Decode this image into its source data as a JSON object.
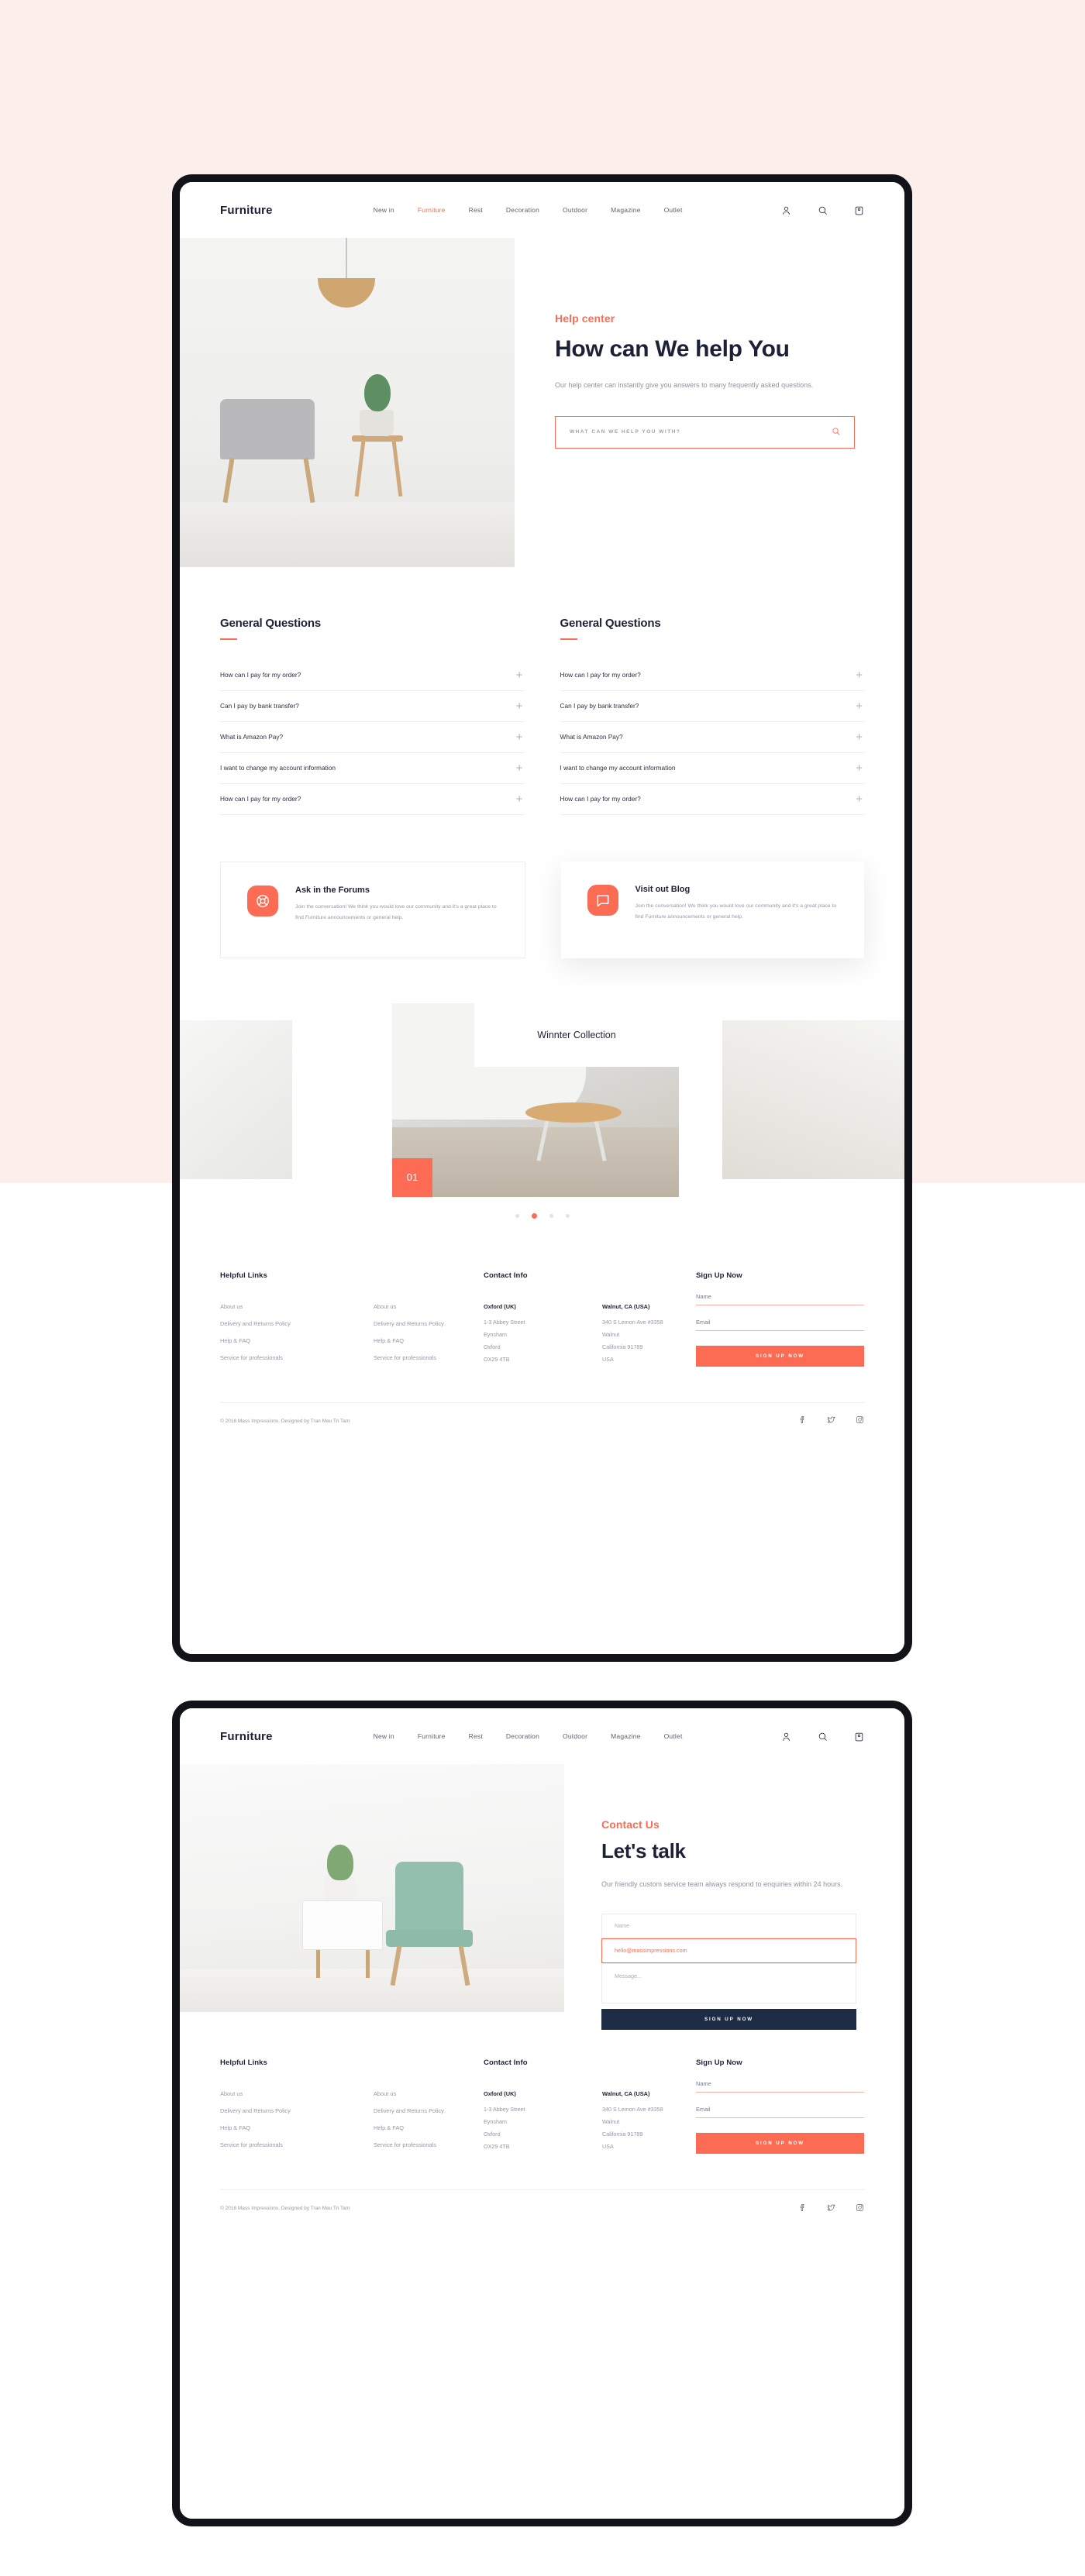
{
  "theme": {
    "page_background": "#fbeeeb",
    "accent": "#fc6b53",
    "dark": "#1d2136",
    "dark_button": "#1d2b44",
    "muted_text": "#9498a8"
  },
  "nav": {
    "brand": "Furniture",
    "links": [
      {
        "label": "New in",
        "active": false
      },
      {
        "label": "Furniture",
        "active": true
      },
      {
        "label": "Rest",
        "active": false
      },
      {
        "label": "Decoration",
        "active": false
      },
      {
        "label": "Outdoor",
        "active": false
      },
      {
        "label": "Magazine",
        "active": false
      },
      {
        "label": "Outlet",
        "active": false
      }
    ],
    "icons": [
      {
        "name": "user-icon"
      },
      {
        "name": "search-icon"
      },
      {
        "name": "cart-icon"
      }
    ]
  },
  "page1": {
    "hero": {
      "eyebrow": "Help center",
      "title": "How can We help You",
      "description": "Our help center can instantly give you answers to many frequently asked questions.",
      "search_placeholder": "WHAT CAN WE HELP YOU WITH?"
    },
    "faq_left": {
      "title": "General Questions",
      "items": [
        "How can I pay for my order?",
        "Can I pay by bank transfer?",
        "What is Amazon Pay?",
        "I want to change my account information",
        "How can I pay for my order?"
      ]
    },
    "faq_right": {
      "title": "General Questions",
      "items": [
        "How can I pay for my order?",
        "Can I pay by bank transfer?",
        "What is Amazon Pay?",
        "I want to change my account information",
        "How can I pay for my order?"
      ]
    },
    "cards": [
      {
        "icon": "lifebuoy-icon",
        "title": "Ask in the Forums",
        "body": "Join the conversation! We think you would love our community and it's a great place to find Furniture announcements or general help."
      },
      {
        "icon": "chat-bubble-icon",
        "title": "Visit out Blog",
        "body": "Join the conversation! We think you would love our community and it's a great place to find Furniture announcements or general help."
      }
    ],
    "carousel": {
      "label": "Winnter Collection",
      "number": "01",
      "dots": 4,
      "active_dot": 1
    }
  },
  "page2": {
    "hero": {
      "eyebrow": "Contact Us",
      "title": "Let's talk",
      "description": "Our friendly custom service team always respond to enquiries within 24 hours."
    },
    "contact_form": {
      "name_placeholder": "Name",
      "email_value": "hello@massimpressions.com",
      "message_placeholder": "Message...",
      "submit_label": "SIGN UP NOW"
    }
  },
  "footer": {
    "helpful_links": {
      "title": "Helpful Links",
      "col1": [
        "About us",
        "Delivery and Returns Policy",
        "Help & FAQ",
        "Service for professionals"
      ],
      "col2": [
        "About us",
        "Delivery and Returns Policy",
        "Help & FAQ",
        "Service for professionals"
      ]
    },
    "contact_info": {
      "title": "Contact Info",
      "addresses": [
        {
          "heading": "Oxford (UK)",
          "lines": [
            "1-3 Abbey Street",
            "Eynsham",
            "Oxford",
            "OX29 4TB"
          ]
        },
        {
          "heading": "Walnut, CA (USA)",
          "lines": [
            "340 S Lemon Ave #3358",
            "Walnut",
            "California 91789",
            "USA"
          ]
        }
      ]
    },
    "signup": {
      "title": "Sign Up Now",
      "name_label": "Name",
      "email_label": "Email",
      "button_label": "SIGN UP NOW"
    },
    "copyright": "© 2018 Mass Impressions. Designed by Tran Mau Tri Tam",
    "socials": [
      {
        "name": "facebook-icon"
      },
      {
        "name": "twitter-icon"
      },
      {
        "name": "instagram-icon"
      }
    ]
  }
}
